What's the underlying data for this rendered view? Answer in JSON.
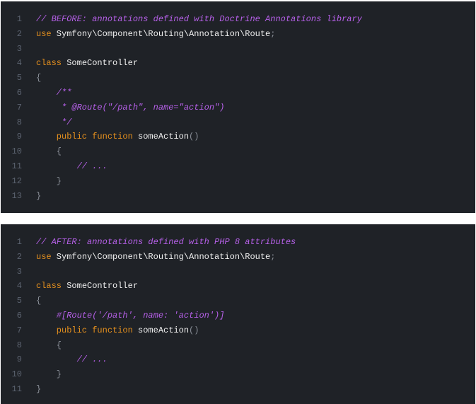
{
  "blocks": [
    {
      "lines": [
        [
          {
            "t": "comment",
            "v": "// BEFORE: annotations defined with Doctrine Annotations library"
          }
        ],
        [
          {
            "t": "kw",
            "v": "use"
          },
          {
            "t": "text",
            "v": " Symfony\\Component\\Routing\\Annotation\\Route"
          },
          {
            "t": "punc",
            "v": ";"
          }
        ],
        [],
        [
          {
            "t": "kw",
            "v": "class"
          },
          {
            "t": "text",
            "v": " SomeController"
          }
        ],
        [
          {
            "t": "punc",
            "v": "{"
          }
        ],
        [
          {
            "t": "comment",
            "v": "    /**"
          }
        ],
        [
          {
            "t": "comment",
            "v": "     * @Route(\"/path\", name=\"action\")"
          }
        ],
        [
          {
            "t": "comment",
            "v": "     */"
          }
        ],
        [
          {
            "t": "kw",
            "v": "    public function"
          },
          {
            "t": "text",
            "v": " someAction"
          },
          {
            "t": "punc",
            "v": "()"
          }
        ],
        [
          {
            "t": "punc",
            "v": "    {"
          }
        ],
        [
          {
            "t": "comment",
            "v": "        // ..."
          }
        ],
        [
          {
            "t": "punc",
            "v": "    }"
          }
        ],
        [
          {
            "t": "punc",
            "v": "}"
          }
        ]
      ]
    },
    {
      "lines": [
        [
          {
            "t": "comment",
            "v": "// AFTER: annotations defined with PHP 8 attributes"
          }
        ],
        [
          {
            "t": "kw",
            "v": "use"
          },
          {
            "t": "text",
            "v": " Symfony\\Component\\Routing\\Annotation\\Route"
          },
          {
            "t": "punc",
            "v": ";"
          }
        ],
        [],
        [
          {
            "t": "kw",
            "v": "class"
          },
          {
            "t": "text",
            "v": " SomeController"
          }
        ],
        [
          {
            "t": "punc",
            "v": "{"
          }
        ],
        [
          {
            "t": "comment",
            "v": "    #[Route('/path', name: 'action')]"
          }
        ],
        [
          {
            "t": "kw",
            "v": "    public function"
          },
          {
            "t": "text",
            "v": " someAction"
          },
          {
            "t": "punc",
            "v": "()"
          }
        ],
        [
          {
            "t": "punc",
            "v": "    {"
          }
        ],
        [
          {
            "t": "comment",
            "v": "        // ..."
          }
        ],
        [
          {
            "t": "punc",
            "v": "    }"
          }
        ],
        [
          {
            "t": "punc",
            "v": "}"
          }
        ]
      ]
    }
  ]
}
